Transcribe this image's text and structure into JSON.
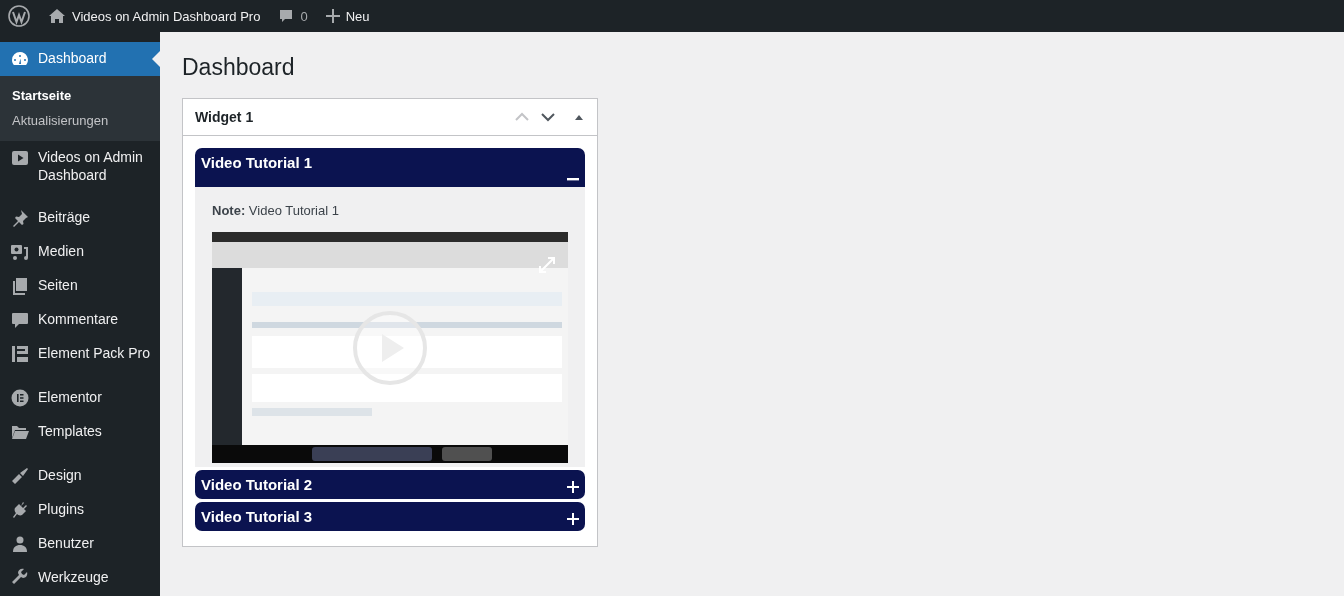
{
  "admin_bar": {
    "site_title": "Videos on Admin Dashboard Pro",
    "comments_count": "0",
    "new_label": "Neu"
  },
  "sidebar": {
    "groups": [
      [
        {
          "label": "Dashboard",
          "selected": true,
          "children": [
            {
              "label": "Startseite",
              "selected": true
            },
            {
              "label": "Aktualisierungen",
              "selected": false
            }
          ]
        },
        {
          "label": "Videos on Admin Dashboard",
          "selected": false
        }
      ],
      [
        {
          "label": "Beiträge",
          "selected": false
        },
        {
          "label": "Medien",
          "selected": false
        },
        {
          "label": "Seiten",
          "selected": false
        },
        {
          "label": "Kommentare",
          "selected": false
        },
        {
          "label": "Element Pack Pro",
          "selected": false
        }
      ],
      [
        {
          "label": "Elementor",
          "selected": false
        },
        {
          "label": "Templates",
          "selected": false
        }
      ],
      [
        {
          "label": "Design",
          "selected": false
        },
        {
          "label": "Plugins",
          "selected": false
        },
        {
          "label": "Benutzer",
          "selected": false
        },
        {
          "label": "Werkzeuge",
          "selected": false
        }
      ]
    ]
  },
  "page_title": "Dashboard",
  "widget": {
    "title": "Widget 1",
    "move_up_disabled": true,
    "expanded": true,
    "sections": [
      {
        "title": "Video Tutorial 1",
        "expanded": true,
        "note_label": "Note:",
        "note_text": "Video Tutorial 1"
      },
      {
        "title": "Video Tutorial 2",
        "expanded": false
      },
      {
        "title": "Video Tutorial 3",
        "expanded": false
      }
    ]
  }
}
